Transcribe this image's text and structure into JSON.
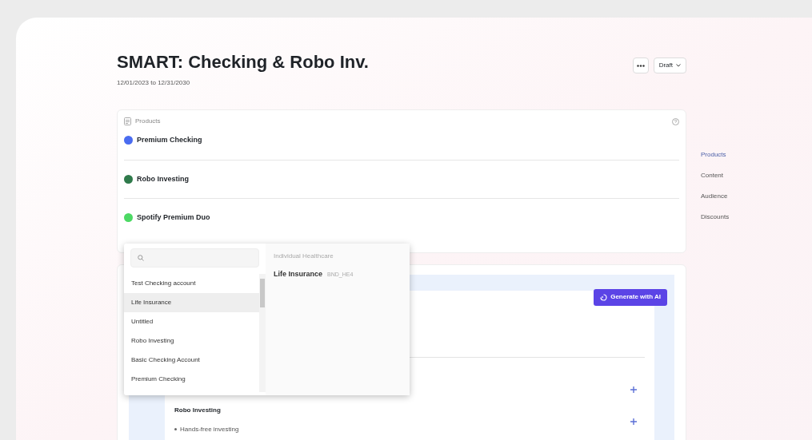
{
  "header": {
    "title": "SMART: Checking & Robo Inv.",
    "date_range": "12/01/2023 to 12/31/2030",
    "status": "Draft"
  },
  "products_card": {
    "title": "Products",
    "items": [
      {
        "name": "Premium Checking",
        "color": "#4a6cf0"
      },
      {
        "name": "Robo Investing",
        "color": "#2f7a4b"
      },
      {
        "name": "Spotify Premium Duo",
        "color": "#4cd964"
      }
    ]
  },
  "product_picker": {
    "options": [
      {
        "label": "Test Checking account",
        "selected": false
      },
      {
        "label": "Life Insurance",
        "selected": true
      },
      {
        "label": "Untitled",
        "selected": false
      },
      {
        "label": "Robo Investing",
        "selected": false
      },
      {
        "label": "Basic Checking Account",
        "selected": false
      },
      {
        "label": "Premium Checking",
        "selected": false
      }
    ],
    "detail": {
      "category": "Individual Healthcare",
      "name": "Life Insurance",
      "code": "BND_HE4"
    }
  },
  "content_card": {
    "generate_button": "Generate with AI",
    "section_title": "Robo Investing",
    "bullets": [
      "Hands-free investing"
    ]
  },
  "nav": [
    {
      "label": "Products",
      "selected": true
    },
    {
      "label": "Content",
      "selected": false
    },
    {
      "label": "Audience",
      "selected": false
    },
    {
      "label": "Discounts",
      "selected": false
    }
  ]
}
